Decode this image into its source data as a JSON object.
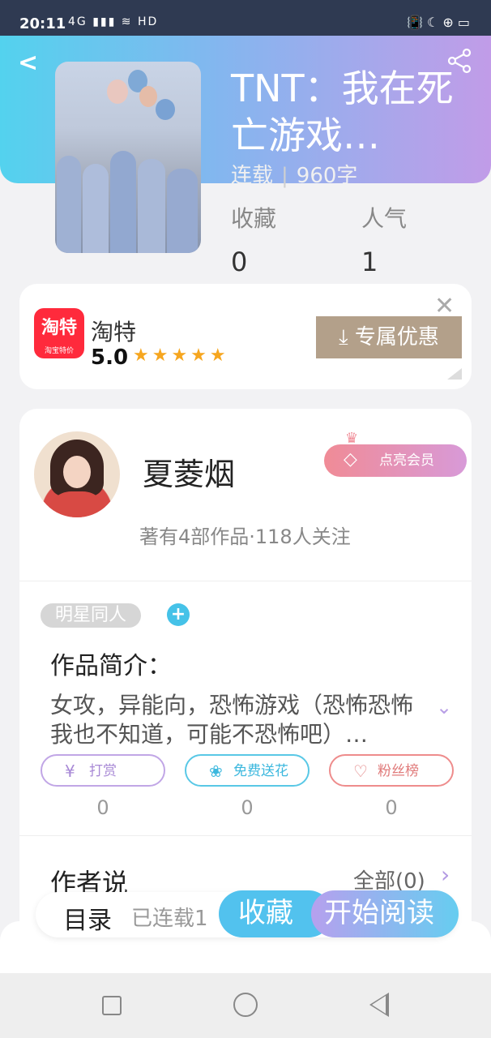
{
  "status_bar": {
    "time": "20:11",
    "network_icons": "4G ▮▮▮ ≋ HD",
    "right_icons": "📳 ☾ ⊕ ▭"
  },
  "book": {
    "title": "TNT：我在死亡游戏…",
    "status": "连载",
    "word_count": "960字",
    "collect_label": "收藏",
    "collect_count": "0",
    "popularity_label": "人气",
    "popularity_count": "1"
  },
  "ad": {
    "logo_text": "淘特",
    "logo_sub": "淘宝特价",
    "name": "淘特",
    "rating": "5.0",
    "stars": "★★★★★",
    "close": "✕",
    "button_label": "专属优惠",
    "button_icon": "⤓"
  },
  "author": {
    "name": "夏菱烟",
    "vip_label": "点亮会员",
    "stats": "著有4部作品·118人关注"
  },
  "intro": {
    "tag": "明星同人",
    "add": "+",
    "title": "作品简介：",
    "text": "女攻，异能向，恐怖游戏（恐怖恐怖我也不知道，可能不恐怖吧）…",
    "expand": "⌄"
  },
  "actions": [
    {
      "label": "打赏",
      "icon": "¥",
      "count": "0"
    },
    {
      "label": "免费送花",
      "icon": "❀",
      "count": "0"
    },
    {
      "label": "粉丝榜",
      "icon": "♡",
      "count": "0"
    }
  ],
  "author_says": {
    "title": "作者说",
    "view_all": "全部(0)",
    "arrow": "›"
  },
  "bottom_bar": {
    "catalog": "目录",
    "serial": "已连载1",
    "collect": "收藏",
    "read": "开始阅读"
  },
  "icons": {
    "back": "back-icon",
    "share": "share-icon",
    "crown": "crown-icon",
    "diamond": "diamond-icon"
  },
  "colors": {
    "header_start": "#53d2ee",
    "header_end": "#c19ce8",
    "ad_button": "#b3a08a",
    "collect_button": "#52c2ee"
  }
}
